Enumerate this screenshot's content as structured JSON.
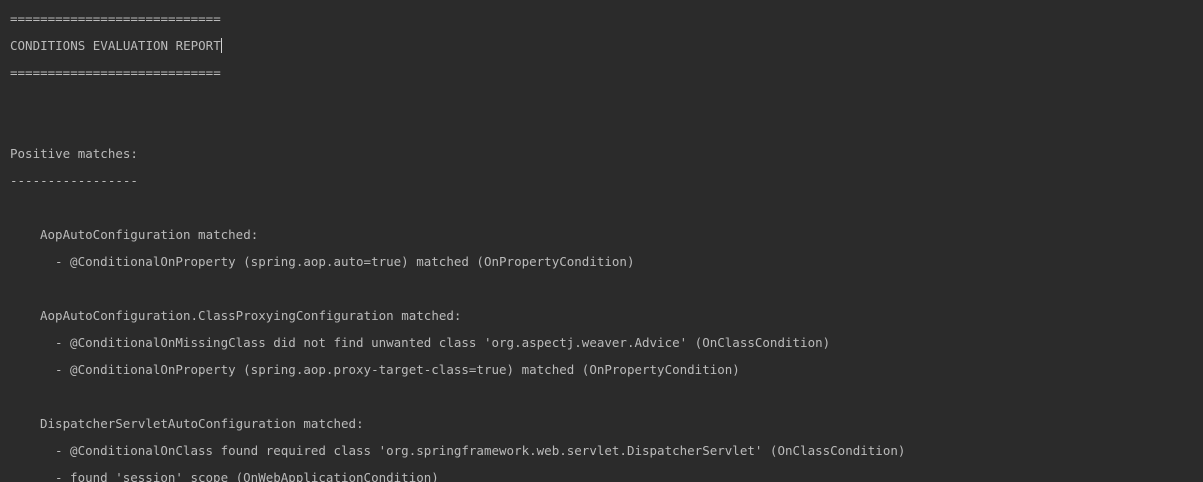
{
  "console": {
    "lines": [
      {
        "text": "============================",
        "indent": 0
      },
      {
        "text": "CONDITIONS EVALUATION REPORT",
        "indent": 0
      },
      {
        "text": "============================",
        "indent": 0
      },
      {
        "text": "",
        "indent": 0
      },
      {
        "text": "",
        "indent": 0
      },
      {
        "text": "Positive matches:",
        "indent": 0
      },
      {
        "text": "-----------------",
        "indent": 0
      },
      {
        "text": "",
        "indent": 0
      },
      {
        "text": "AopAutoConfiguration matched:",
        "indent": 1
      },
      {
        "text": "- @ConditionalOnProperty (spring.aop.auto=true) matched (OnPropertyCondition)",
        "indent": 2
      },
      {
        "text": "",
        "indent": 0
      },
      {
        "text": "AopAutoConfiguration.ClassProxyingConfiguration matched:",
        "indent": 1
      },
      {
        "text": "- @ConditionalOnMissingClass did not find unwanted class 'org.aspectj.weaver.Advice' (OnClassCondition)",
        "indent": 2
      },
      {
        "text": "- @ConditionalOnProperty (spring.aop.proxy-target-class=true) matched (OnPropertyCondition)",
        "indent": 2
      },
      {
        "text": "",
        "indent": 0
      },
      {
        "text": "DispatcherServletAutoConfiguration matched:",
        "indent": 1
      },
      {
        "text": "- @ConditionalOnClass found required class 'org.springframework.web.servlet.DispatcherServlet' (OnClassCondition)",
        "indent": 2
      },
      {
        "text": "- found 'session' scope (OnWebApplicationCondition)",
        "indent": 2
      }
    ]
  },
  "theme": {
    "background": "#2b2b2b",
    "text": "#bbbbbb",
    "caret": "#d4d4d4"
  }
}
